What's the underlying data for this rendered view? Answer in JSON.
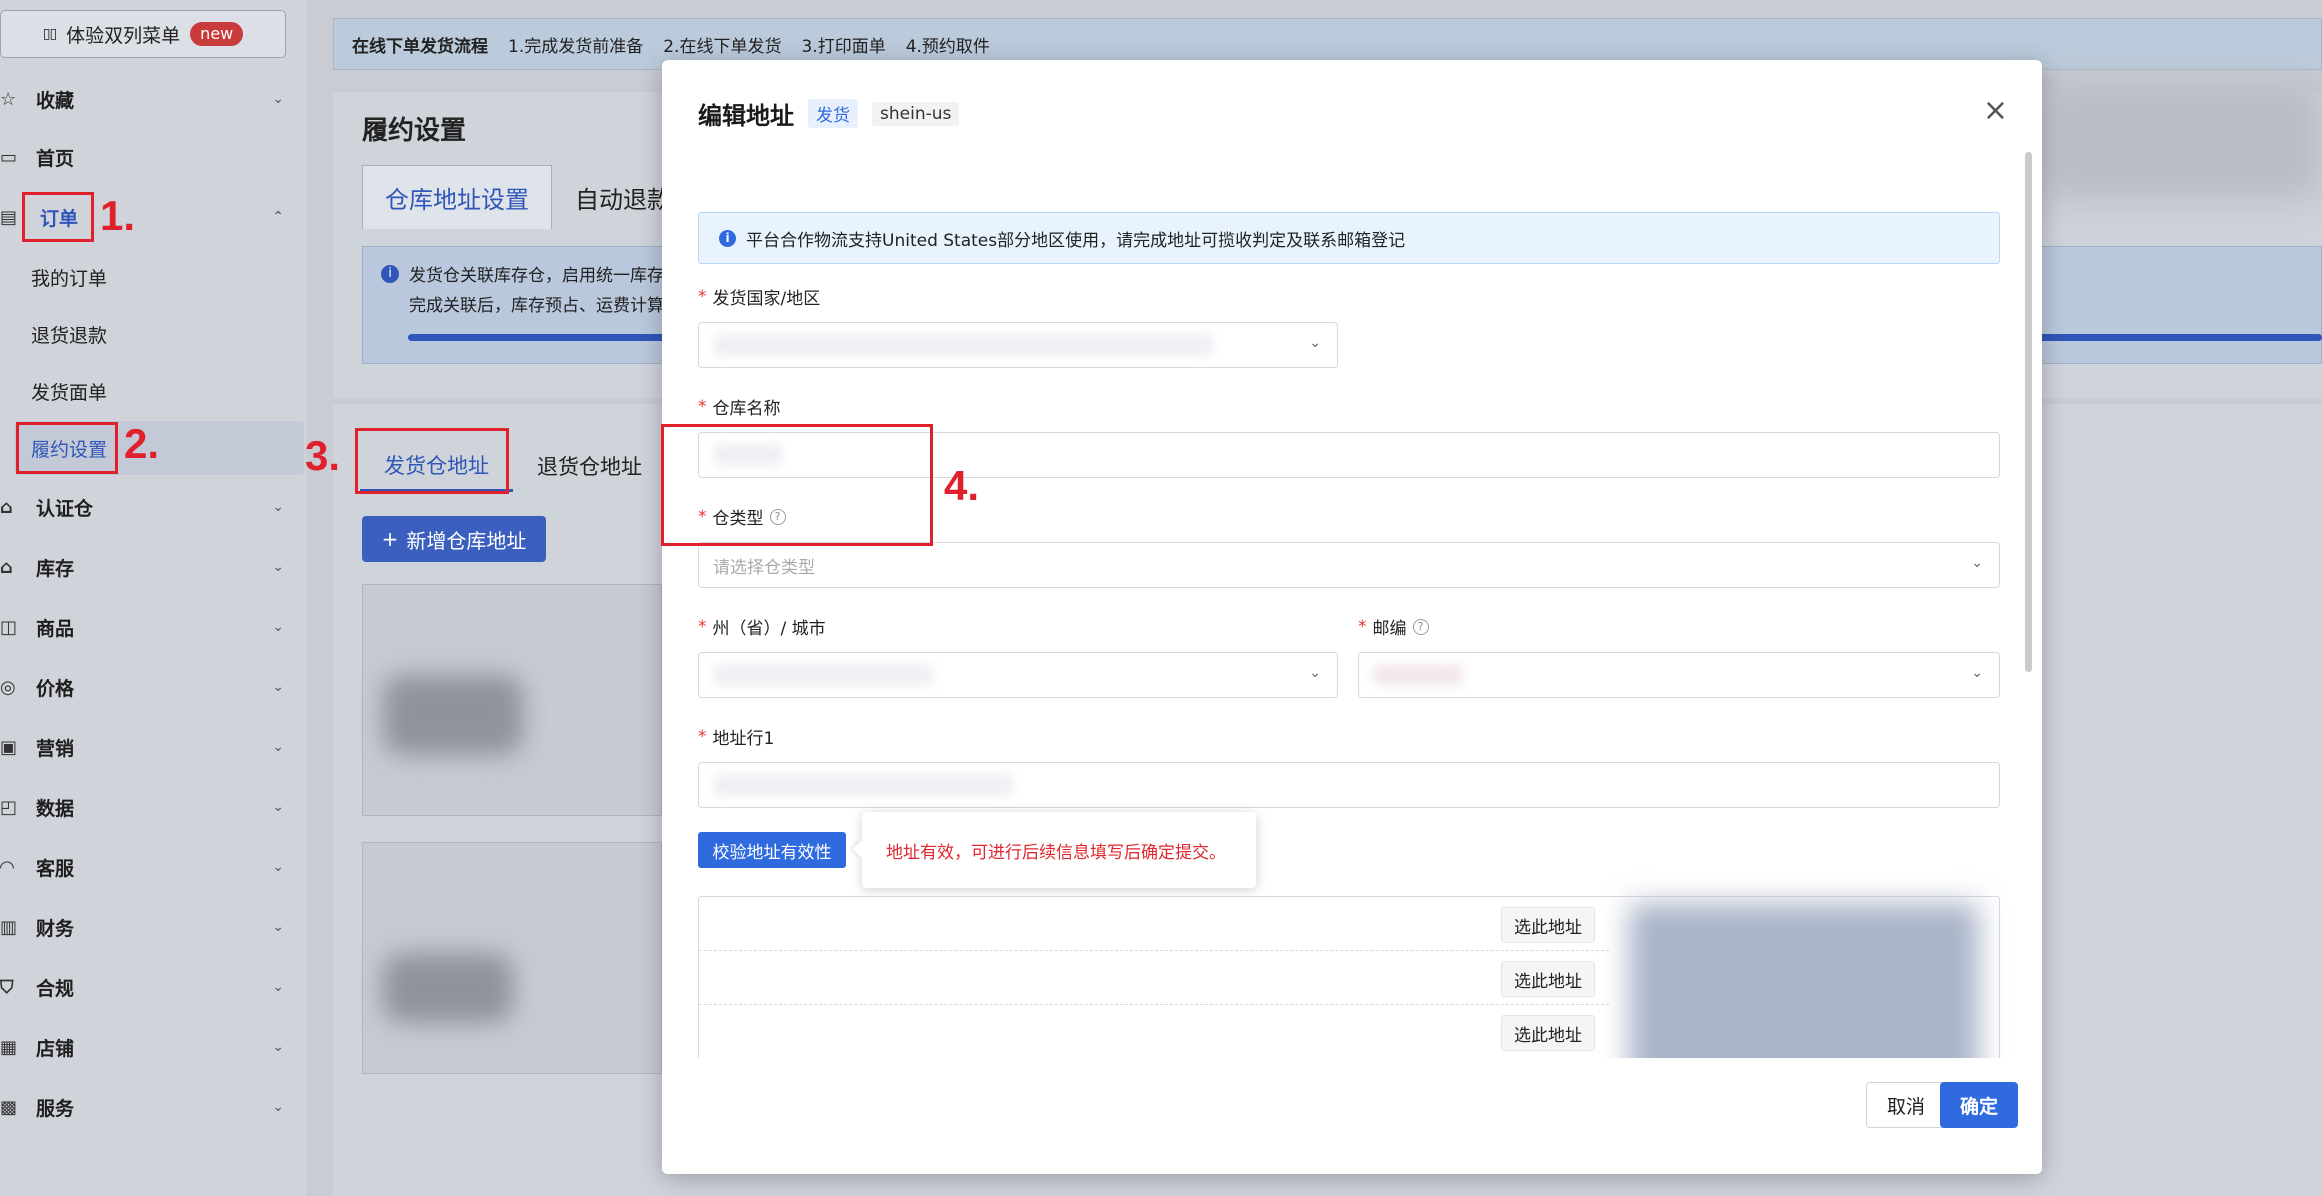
{
  "sidebar": {
    "toggle_label": "体验双列菜单",
    "toggle_badge": "new",
    "items": [
      {
        "label": "收藏",
        "icon": "star-icon"
      },
      {
        "label": "首页",
        "icon": "monitor-icon"
      },
      {
        "label": "订单",
        "icon": "order-icon"
      },
      {
        "label": "认证仓",
        "icon": "warehouse-check-icon"
      },
      {
        "label": "库存",
        "icon": "house-icon"
      },
      {
        "label": "商品",
        "icon": "product-icon"
      },
      {
        "label": "价格",
        "icon": "coin-icon"
      },
      {
        "label": "营销",
        "icon": "marketing-icon"
      },
      {
        "label": "数据",
        "icon": "chart-icon"
      },
      {
        "label": "客服",
        "icon": "headset-icon"
      },
      {
        "label": "财务",
        "icon": "wallet-icon"
      },
      {
        "label": "合规",
        "icon": "shield-icon"
      },
      {
        "label": "店铺",
        "icon": "store-icon"
      },
      {
        "label": "服务",
        "icon": "service-icon"
      }
    ],
    "order_sub": [
      "我的订单",
      "退货退款",
      "发货面单",
      "履约设置"
    ]
  },
  "steps_bar": {
    "title": "在线下单发货流程",
    "steps": [
      "1.完成发货前准备",
      "2.在线下单发货",
      "3.打印面单",
      "4.预约取件"
    ]
  },
  "page": {
    "title": "履约设置",
    "tabs": [
      "仓库地址设置",
      "自动退款"
    ],
    "info_line1": "发货仓关联库存仓，启用统一库存",
    "info_line2": "完成关联后，库存预占、运费计算",
    "sub_tabs": [
      "发货仓地址",
      "退货仓地址"
    ],
    "add_button": "新增仓库地址"
  },
  "annotations": [
    "1.",
    "2.",
    "3.",
    "4."
  ],
  "modal": {
    "title": "编辑地址",
    "tag_ship": "发货",
    "tag_site": "shein-us",
    "notice": "平台合作物流支持United States部分地区使用，请完成地址可揽收判定及联系邮箱登记",
    "fields": {
      "country": "发货国家/地区",
      "warehouse_name": "仓库名称",
      "warehouse_type": "仓类型",
      "warehouse_type_placeholder": "请选择仓类型",
      "state_city": "州（省）/ 城市",
      "zip": "邮编",
      "address1": "地址行1"
    },
    "validate_button": "校验地址有效性",
    "validate_result": "地址有效，可进行后续信息填写后确定提交。",
    "pick_label": "选此地址",
    "cancel": "取消",
    "confirm": "确定"
  },
  "colors": {
    "accent": "#2f6bdf",
    "annotation_red": "#e0202a",
    "required": "#e33"
  }
}
